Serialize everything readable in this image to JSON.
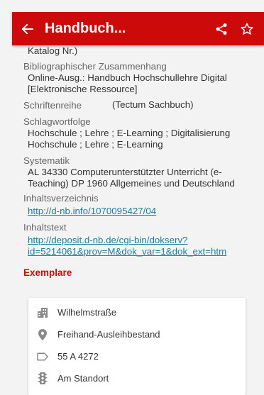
{
  "appbar": {
    "title": "Handbuch...",
    "back_icon": "arrow-left-icon",
    "share_icon": "share-icon",
    "favorite_icon": "star-outline-icon"
  },
  "details": {
    "katalog_fragment": "Katalog Nr.)",
    "bib_label": "Bibliographischer Zusammenhang",
    "bib_value_line1": "Online-Ausg.: Handbuch Hochschullehre Digital",
    "bib_value_line2": "[Elektronische Ressource]",
    "series_label": "Schriftenreihe",
    "series_value": "(Tectum Sachbuch)",
    "subjects_label": "Schlagwortfolge",
    "subjects_line1": "Hochschule ; Lehre ; E-Learning ; Digitalisierung",
    "subjects_line2": "Hochschule ; Lehre ; E-Learning",
    "systematik_label": "Systematik",
    "systematik_line1": "AL 34330 Computerunterstützter Unterricht (e-",
    "systematik_line2": "Teaching) DP 1960 Allgemeines und Deutschland",
    "toc_label": "Inhaltsverzeichnis",
    "toc_link": "http://d-nb.info/1070095427/04",
    "content_label": "Inhaltstext",
    "content_link_line1": "http://deposit.d-nb.de/cgi-bin/dokserv?",
    "content_link_line2": "id=5214061&prov=M&dok_var=1&dok_ext=htm"
  },
  "exemplare": {
    "title": "Exemplare",
    "items": [
      {
        "icon": "building-icon",
        "text": "Wilhelmstraße"
      },
      {
        "icon": "location-pin-icon",
        "text": "Freihand-Ausleihbestand"
      },
      {
        "icon": "label-tag-icon",
        "text": "55 A 4272"
      },
      {
        "icon": "traffic-light-icon",
        "text": "Am Standort"
      }
    ]
  },
  "colors": {
    "brand_red": "#cc0a0a",
    "link": "#1c7f9a"
  }
}
